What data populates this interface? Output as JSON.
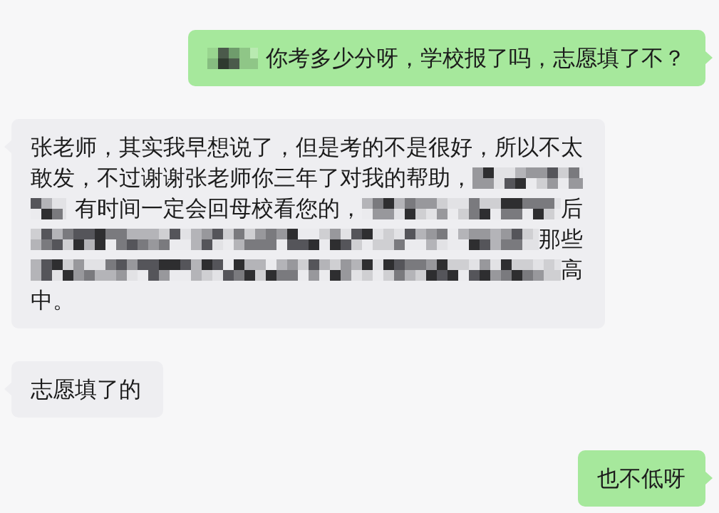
{
  "messages": [
    {
      "kind": "outgoing",
      "lines": [
        [
          {
            "kind": "mosaic"
          },
          {
            "kind": "text",
            "text": "你考多少分呀，学校报了吗，志愿填了不？"
          }
        ]
      ]
    },
    {
      "kind": "incoming",
      "lines": [
        [
          {
            "kind": "text",
            "text": "张老师，其实我早想说了，但是考的不是很好，所以不太"
          }
        ],
        [
          {
            "kind": "text",
            "text": "敢发，不过谢谢张老师你三年了对我的帮助，"
          },
          {
            "kind": "mosaic"
          }
        ],
        [
          {
            "kind": "mosaic"
          },
          {
            "kind": "text",
            "text": "有时间一定会回母校看您的，"
          },
          {
            "kind": "mosaic"
          },
          {
            "kind": "text",
            "text": "后"
          }
        ],
        [
          {
            "kind": "mosaic"
          },
          {
            "kind": "text",
            "text": "那些"
          }
        ],
        [
          {
            "kind": "mosaic"
          },
          {
            "kind": "text",
            "text": "高"
          }
        ],
        [
          {
            "kind": "text",
            "text": "中。"
          }
        ]
      ]
    },
    {
      "kind": "incoming",
      "lines": [
        [
          {
            "kind": "text",
            "text": "志愿填了的"
          }
        ]
      ]
    },
    {
      "kind": "outgoing",
      "lines": [
        [
          {
            "kind": "text",
            "text": "也不低呀"
          }
        ]
      ]
    }
  ]
}
